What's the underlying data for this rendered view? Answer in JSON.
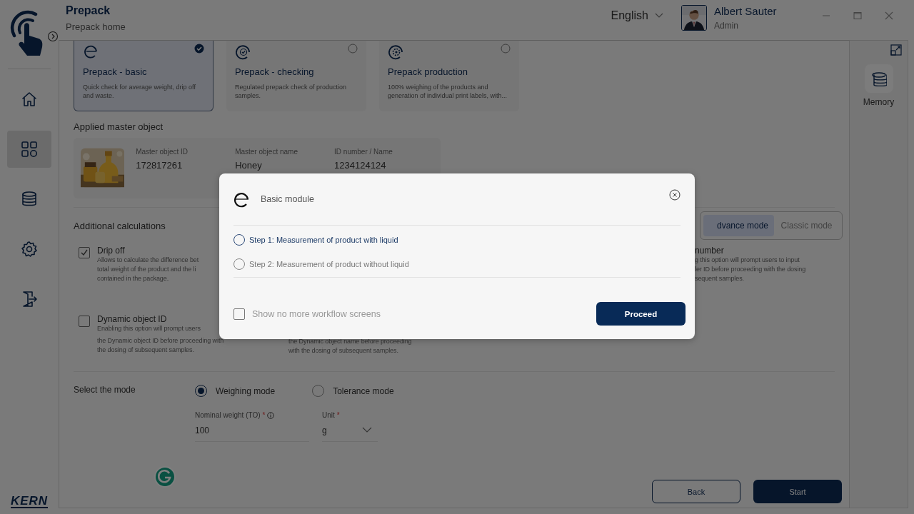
{
  "header": {
    "title": "Prepack",
    "subtitle": "Prepack home",
    "language": "English",
    "user": {
      "name": "Albert Sauter",
      "role": "Admin"
    }
  },
  "nav": [
    {
      "kind": "home",
      "selected": false
    },
    {
      "kind": "apps",
      "selected": true
    },
    {
      "kind": "database",
      "selected": false
    },
    {
      "kind": "settings",
      "selected": false
    },
    {
      "kind": "exit",
      "selected": false
    }
  ],
  "brand": "KERN",
  "modules": [
    {
      "kind": "basic",
      "title": "Prepack - basic",
      "description": "Quick check for average weight, drip off and waste.",
      "selected": true
    },
    {
      "kind": "checking",
      "title": "Prepack - checking",
      "description": "Regulated prepack check of production samples.",
      "selected": false
    },
    {
      "kind": "production",
      "title": "Prepack production",
      "description": "100% weighing of the products and generation of individual print labels, with...",
      "selected": false
    }
  ],
  "master_object": {
    "heading": "Applied master object",
    "fields": [
      {
        "label": "Master object ID",
        "value": "172817261"
      },
      {
        "label": "Master object name",
        "value": "Honey"
      },
      {
        "label": "ID number / Name",
        "value": "1234124124"
      }
    ]
  },
  "calculations": {
    "heading": "Additional calculations",
    "mode_toggle": [
      {
        "label": "dvance mode",
        "selected": true
      },
      {
        "label": "Classic mode",
        "selected": false
      }
    ],
    "rows": [
      {
        "left": {
          "title": "Drip off",
          "checked": true,
          "lines": [
            "Allows to calculate the difference bet",
            "total weight of the product and the li",
            "contained in the package."
          ]
        },
        "right": {
          "title": "number",
          "lines": [
            "g this option will prompt users to input",
            "ler ID before proceeding with the dosing",
            "sequent samples."
          ]
        }
      },
      {
        "left": {
          "title": "Dynamic object ID",
          "checked": false,
          "lines": [
            "Enabling this option will prompt users",
            "the Dynamic object ID before proceeding with",
            "the dosing of subsequent samples."
          ]
        },
        "middle": {
          "lines": [
            "the Dynamic object name before proceeding",
            "with the dosing of subsequent samples."
          ]
        }
      }
    ]
  },
  "mode": {
    "label": "Select the mode",
    "options": [
      {
        "label": "Weighing mode",
        "selected": true
      },
      {
        "label": "Tolerance mode",
        "selected": false
      }
    ],
    "fields": [
      {
        "kind": "text",
        "label": "Nominal weight (TO)",
        "mark": "*",
        "info": true,
        "value": "100"
      },
      {
        "kind": "select",
        "label": "Unit",
        "mark": "*",
        "info": false,
        "value": "g"
      }
    ]
  },
  "actions": [
    {
      "kind": "secondary",
      "label": "Back"
    },
    {
      "kind": "primary",
      "label": "Start"
    }
  ],
  "side_panel": {
    "items": [
      {
        "kind": "memory",
        "label": "Memory"
      }
    ]
  },
  "dialog": {
    "title": "Basic module",
    "steps": [
      {
        "label": "Step 1: Measurement of product with liquid",
        "active": true,
        "selected": false
      },
      {
        "label": "Step 2: Measurement of product without liquid",
        "active": false,
        "selected": false
      }
    ],
    "dont_show": {
      "label": "Show no more workflow screens",
      "checked": false
    },
    "button": "Proceed"
  }
}
